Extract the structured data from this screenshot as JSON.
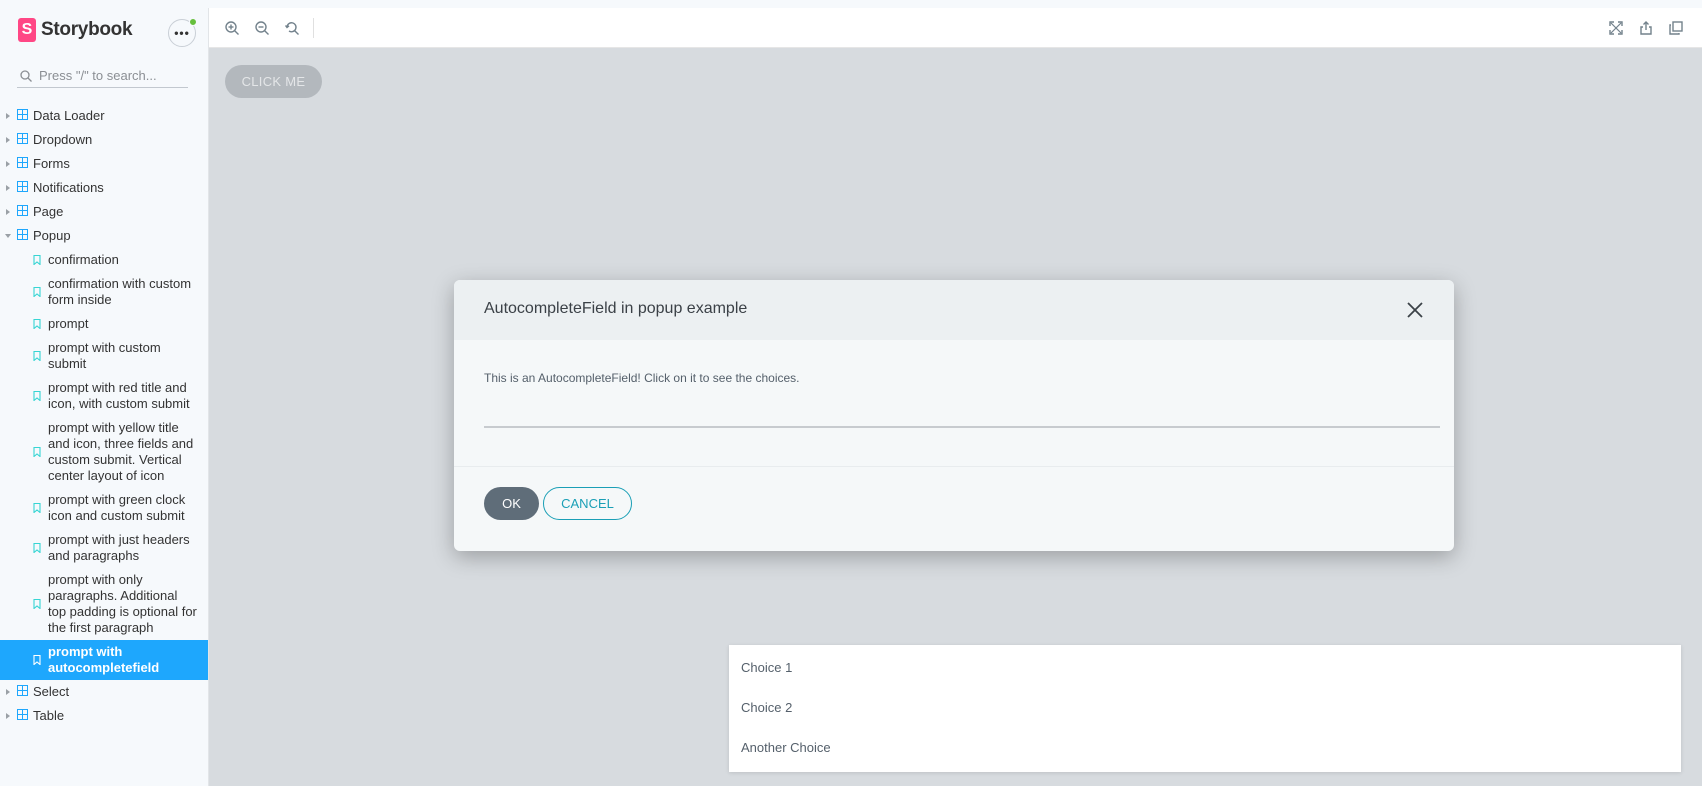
{
  "brand": {
    "name": "Storybook",
    "mark": "S"
  },
  "search": {
    "placeholder": "Press \"/\" to search..."
  },
  "sidebar": {
    "groups_before": [
      {
        "label": "Data Loader"
      },
      {
        "label": "Dropdown"
      },
      {
        "label": "Forms"
      },
      {
        "label": "Notifications"
      },
      {
        "label": "Page"
      }
    ],
    "open_group": {
      "label": "Popup"
    },
    "stories": [
      {
        "label": "confirmation"
      },
      {
        "label": "confirmation with custom form inside"
      },
      {
        "label": "prompt"
      },
      {
        "label": "prompt with custom submit"
      },
      {
        "label": "prompt with red title and icon, with custom submit"
      },
      {
        "label": "prompt with yellow title and icon, three fields and custom submit. Vertical center layout of icon"
      },
      {
        "label": "prompt with green clock icon and custom submit"
      },
      {
        "label": "prompt with just headers and paragraphs"
      },
      {
        "label": "prompt with only paragraphs. Additional top padding is optional for the first paragraph"
      },
      {
        "label": "prompt with autocompletefield"
      }
    ],
    "groups_after": [
      {
        "label": "Select"
      },
      {
        "label": "Table"
      }
    ]
  },
  "toolbar": {
    "icons": [
      "zoom-in-icon",
      "zoom-out-icon",
      "zoom-reset-icon",
      "fullscreen-icon",
      "share-icon",
      "copy-icon"
    ]
  },
  "canvas": {
    "click_me_label": "CLICK ME"
  },
  "modal": {
    "title": "AutocompleteField in popup example",
    "field_label": "This is an AutocompleteField! Click on it to see the choices.",
    "field_value": "",
    "ok_label": "OK",
    "cancel_label": "CANCEL"
  },
  "dropdown": {
    "choices": [
      "Choice 1",
      "Choice 2",
      "Another Choice"
    ]
  },
  "colors": {
    "accent": "#1ea7fd",
    "brand": "#ff4785",
    "status_dot": "#66bf3c",
    "cancel_outline": "#1a9fb6"
  }
}
